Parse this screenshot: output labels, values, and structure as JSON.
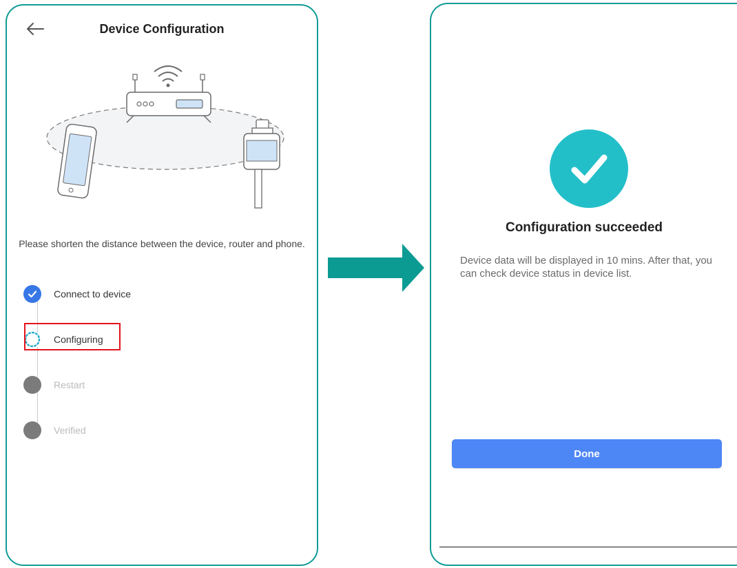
{
  "left_screen": {
    "header": {
      "title": "Device Configuration",
      "back_icon": "back-arrow-icon"
    },
    "hint": "Please shorten the distance between the device, router and phone.",
    "steps": [
      {
        "label": "Connect to device",
        "state": "done"
      },
      {
        "label": "Configuring",
        "state": "in-progress"
      },
      {
        "label": "Restart",
        "state": "pending"
      },
      {
        "label": "Verified",
        "state": "pending"
      }
    ],
    "highlighted_step": "Configuring"
  },
  "right_screen": {
    "status_icon": "checkmark-icon",
    "title": "Configuration succeeded",
    "description": "Device data will be displayed in 10 mins. After that, you can check device status in device list.",
    "done_label": "Done"
  },
  "colors": {
    "frame": "#0f9b96",
    "arrow": "#0c9b93",
    "success": "#23bfc9",
    "button": "#4d86f5",
    "step_done": "#3777e6",
    "step_pending": "#7b7b7b",
    "highlight": "#e3121b"
  }
}
